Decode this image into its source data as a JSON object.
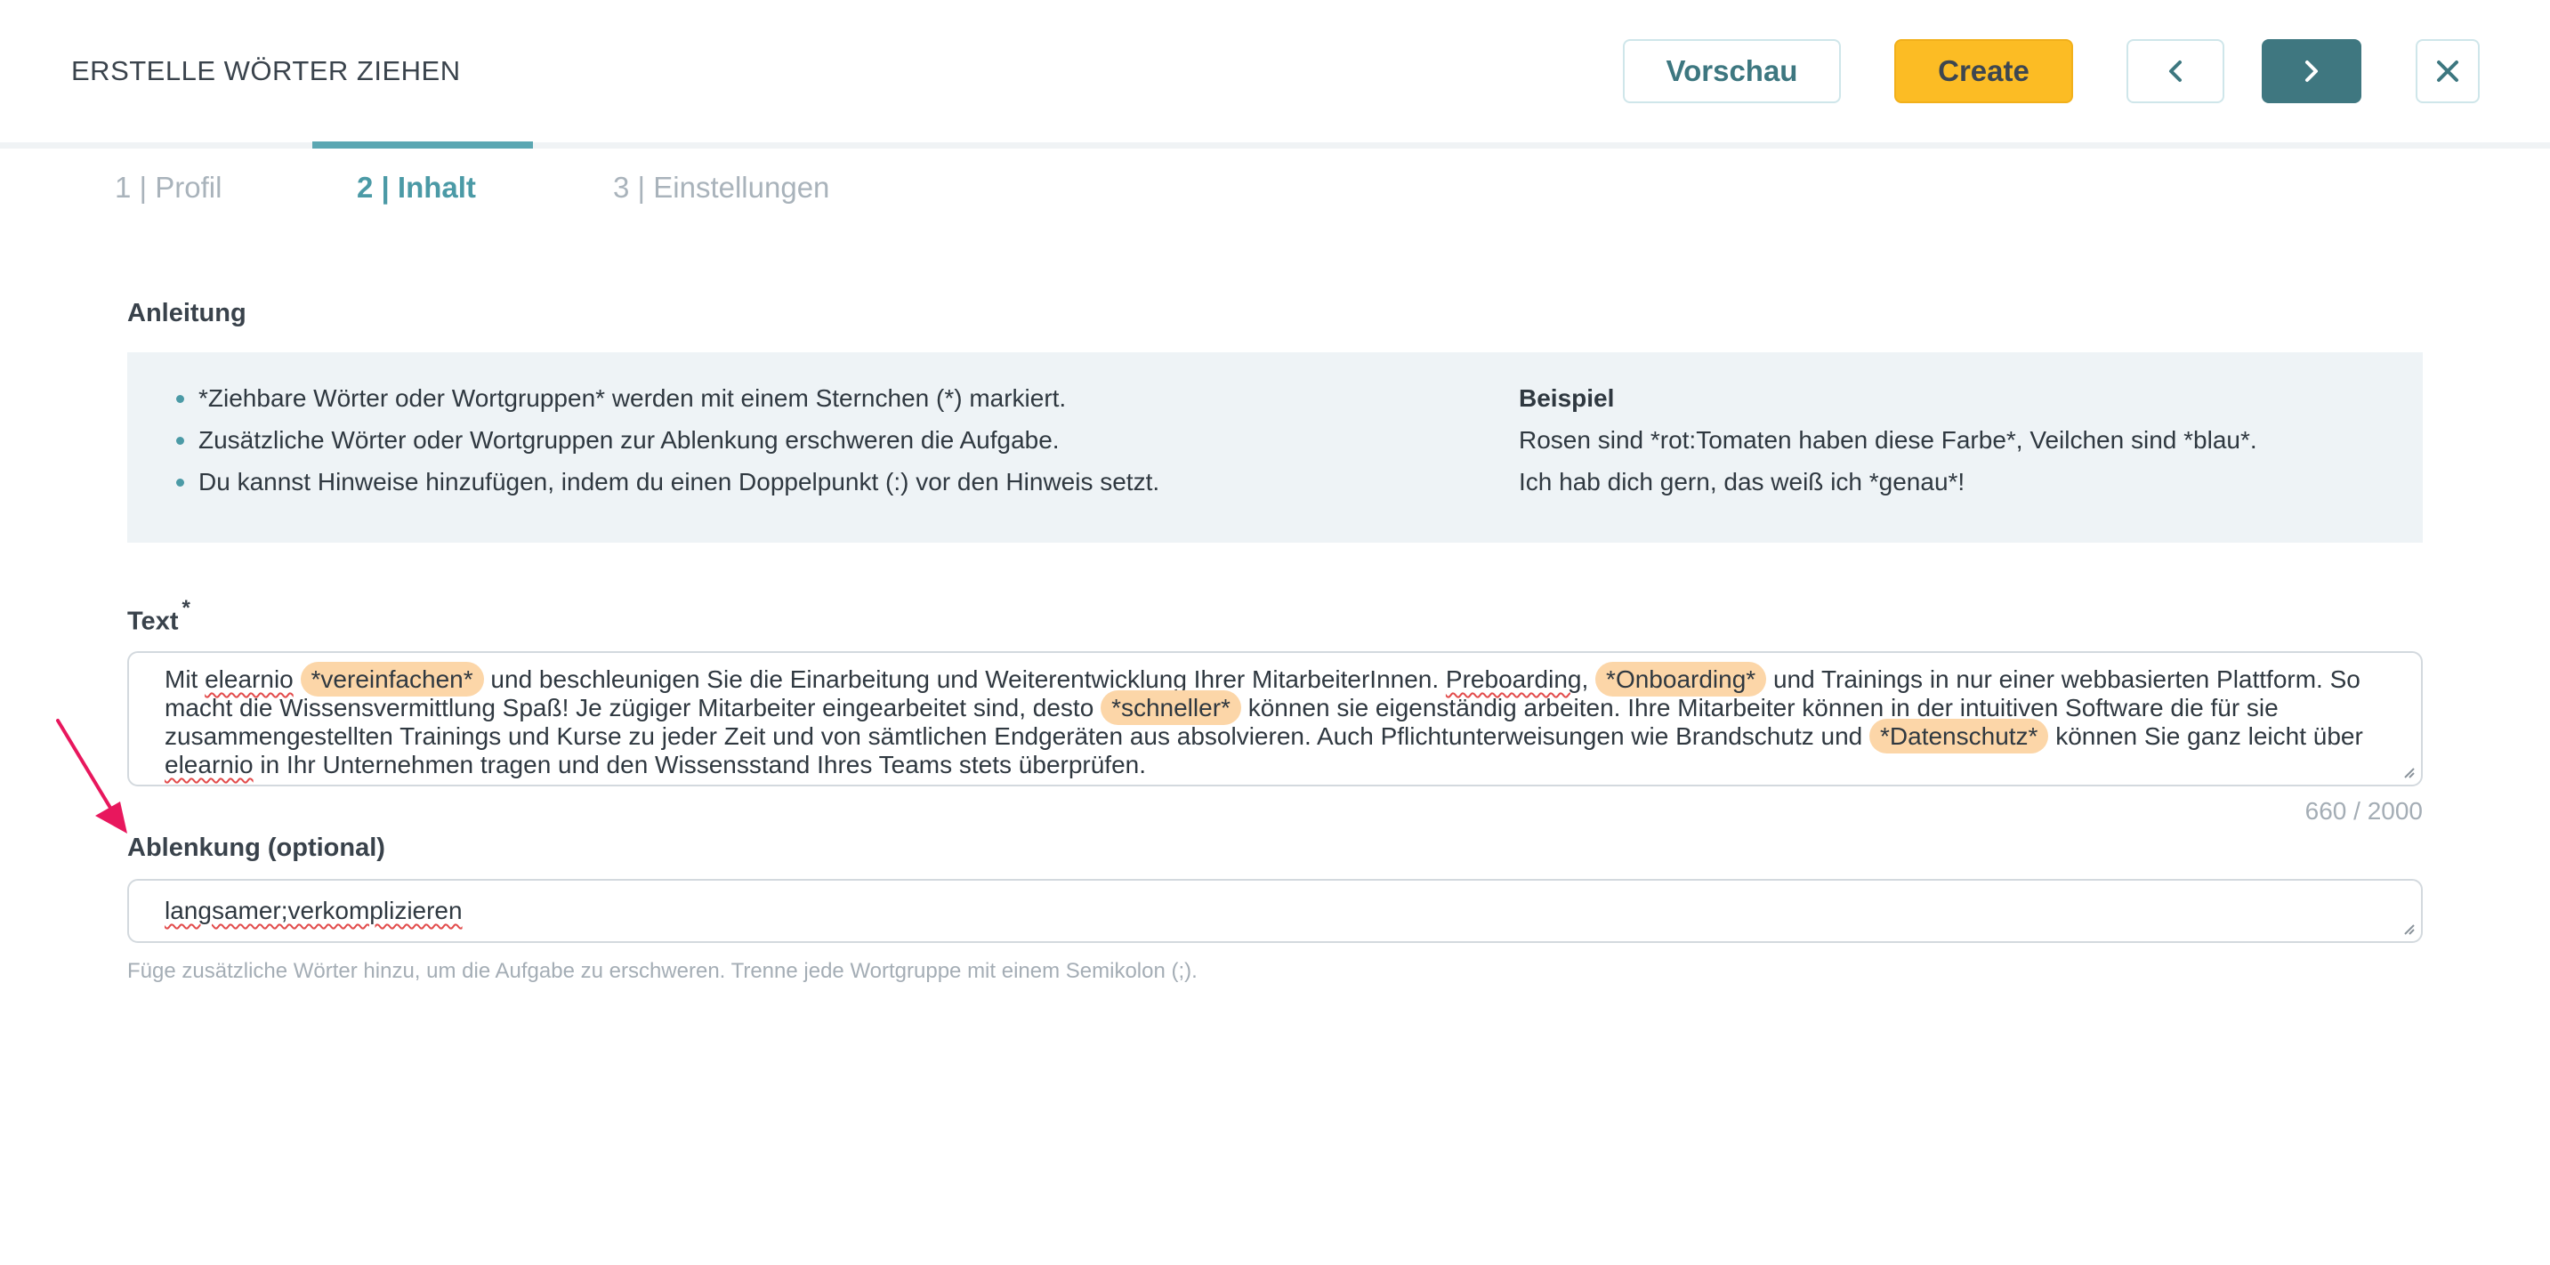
{
  "header": {
    "title": "ERSTELLE WÖRTER ZIEHEN",
    "preview_label": "Vorschau",
    "create_label": "Create",
    "prev_icon": "chevron-left-icon",
    "next_icon": "chevron-right-icon",
    "close_icon": "close-icon"
  },
  "tabs": [
    {
      "label": "1 | Profil",
      "active": false
    },
    {
      "label": "2 | Inhalt",
      "active": true
    },
    {
      "label": "3 | Einstellungen",
      "active": false
    }
  ],
  "instructions": {
    "heading": "Anleitung",
    "items": [
      "*Ziehbare Wörter oder Wortgruppen* werden mit einem Sternchen (*) markiert.",
      "Zusätzliche Wörter oder Wortgruppen zur Ablenkung erschweren die Aufgabe.",
      "Du kannst Hinweise hinzufügen, indem du einen Doppelpunkt (:) vor den Hinweis setzt."
    ],
    "example": {
      "title": "Beispiel",
      "lines": [
        "Rosen sind *rot:Tomaten haben diese Farbe*, Veilchen sind *blau*.",
        "Ich hab dich gern, das weiß ich *genau*!"
      ]
    }
  },
  "text_field": {
    "label": "Text",
    "required_mark": "*",
    "segments": [
      {
        "t": "Mit ",
        "type": "plain"
      },
      {
        "t": "elearnio",
        "type": "spell"
      },
      {
        "t": " ",
        "type": "plain"
      },
      {
        "t": "*vereinfachen*",
        "type": "highlight"
      },
      {
        "t": " und beschleunigen Sie die Einarbeitung und Weiterentwicklung Ihrer MitarbeiterInnen. ",
        "type": "plain"
      },
      {
        "t": "Preboarding",
        "type": "spell"
      },
      {
        "t": ", ",
        "type": "plain"
      },
      {
        "t": "*Onboarding*",
        "type": "highlight"
      },
      {
        "t": " und Trainings in nur einer webbasierten Plattform. So macht die Wissensvermittlung Spaß! Je zügiger Mitarbeiter eingearbeitet sind, desto ",
        "type": "plain"
      },
      {
        "t": "*schneller*",
        "type": "highlight"
      },
      {
        "t": " können sie eigenständig arbeiten. Ihre Mitarbeiter können in der intuitiven Software die für sie zusammengestellten Trainings und Kurse zu jeder Zeit und von sämtlichen Endgeräten aus absolvieren. Auch Pflichtunterweisungen wie Brandschutz und ",
        "type": "plain"
      },
      {
        "t": "*Datenschutz*",
        "type": "highlight"
      },
      {
        "t": " können Sie ganz leicht über ",
        "type": "plain"
      },
      {
        "t": "elearnio",
        "type": "spell"
      },
      {
        "t": " in Ihr Unternehmen tragen und den Wissensstand Ihres Teams stets überprüfen.",
        "type": "plain"
      }
    ],
    "counter": "660 / 2000"
  },
  "distraction_field": {
    "label": "Ablenkung (optional)",
    "value": "langsamer;verkomplizieren",
    "hint": "Füge zusätzliche Wörter hinzu, um die Aufgabe zu erschweren. Trenne jede Wortgruppe mit einem Semikolon (;)."
  },
  "colors": {
    "accent": "#4b9aa6",
    "primary_button": "#fcbc24",
    "next_button": "#3f7780",
    "highlight": "#fcd6a8",
    "annotation_arrow": "#e8175d"
  }
}
